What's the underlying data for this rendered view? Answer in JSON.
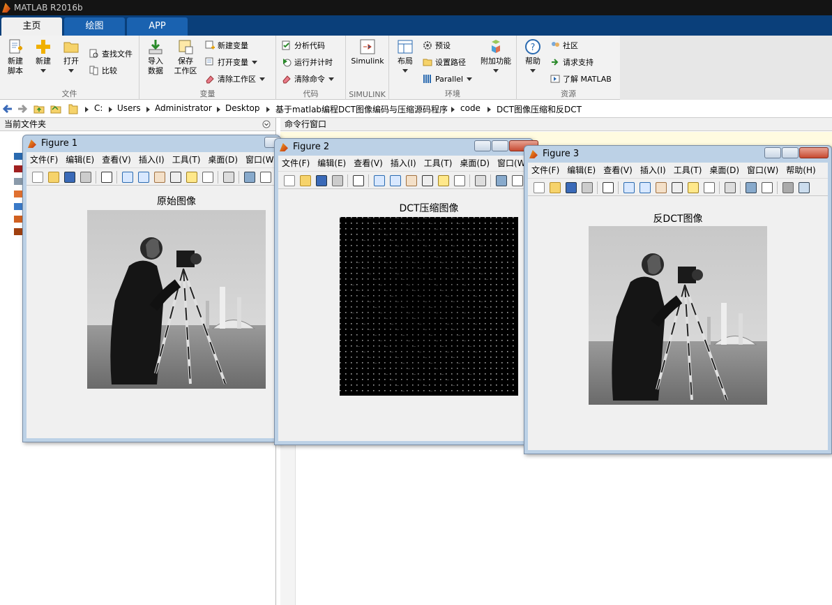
{
  "window": {
    "title": "MATLAB R2016b"
  },
  "tabs": [
    {
      "label": "主页"
    },
    {
      "label": "绘图"
    },
    {
      "label": "APP"
    }
  ],
  "ribbon": {
    "file": {
      "label": "文件",
      "new_script": "新建\n脚本",
      "new": "新建",
      "open": "打开",
      "find_files": "查找文件",
      "compare": "比较"
    },
    "variable": {
      "label": "变量",
      "import": "导入\n数据",
      "save": "保存\n工作区",
      "new_var": "新建变量",
      "open_var": "打开变量",
      "clear_ws": "清除工作区"
    },
    "code": {
      "label": "代码",
      "analyze": "分析代码",
      "run_time": "运行并计时",
      "clear_cmd": "清除命令"
    },
    "simulink": {
      "label": "SIMULINK",
      "btn": "Simulink"
    },
    "env": {
      "label": "环境",
      "layout": "布局",
      "prefs": "预设",
      "set_path": "设置路径",
      "parallel": "Parallel",
      "addons": "附加功能"
    },
    "resources": {
      "label": "资源",
      "help": "帮助",
      "community": "社区",
      "support": "请求支持",
      "learn": "了解 MATLAB"
    }
  },
  "address": {
    "path": [
      "C:",
      "Users",
      "Administrator",
      "Desktop",
      "基于matlab编程DCT图像编码与压缩源码程序",
      "code",
      "DCT图像压缩和反DCT"
    ]
  },
  "panels": {
    "current_folder": "当前文件夹",
    "command_window": "命令行窗口"
  },
  "figures": [
    {
      "title": "Figure 1",
      "axes_title": "原始图像",
      "menu": [
        "文件(F)",
        "编辑(E)",
        "查看(V)",
        "插入(I)",
        "工具(T)",
        "桌面(D)",
        "窗口(W)"
      ]
    },
    {
      "title": "Figure 2",
      "axes_title": "DCT压缩图像",
      "menu": [
        "文件(F)",
        "编辑(E)",
        "查看(V)",
        "插入(I)",
        "工具(T)",
        "桌面(D)",
        "窗口(W)"
      ]
    },
    {
      "title": "Figure 3",
      "axes_title": "反DCT图像",
      "menu": [
        "文件(F)",
        "编辑(E)",
        "查看(V)",
        "插入(I)",
        "工具(T)",
        "桌面(D)",
        "窗口(W)",
        "帮助(H)"
      ]
    }
  ],
  "colors": {
    "ribbon_bg": "#f2f2f2",
    "tab_active": "#f0f0f0",
    "tabbar": "#0a3f7a",
    "figure_frame": "#bcd1e6"
  }
}
